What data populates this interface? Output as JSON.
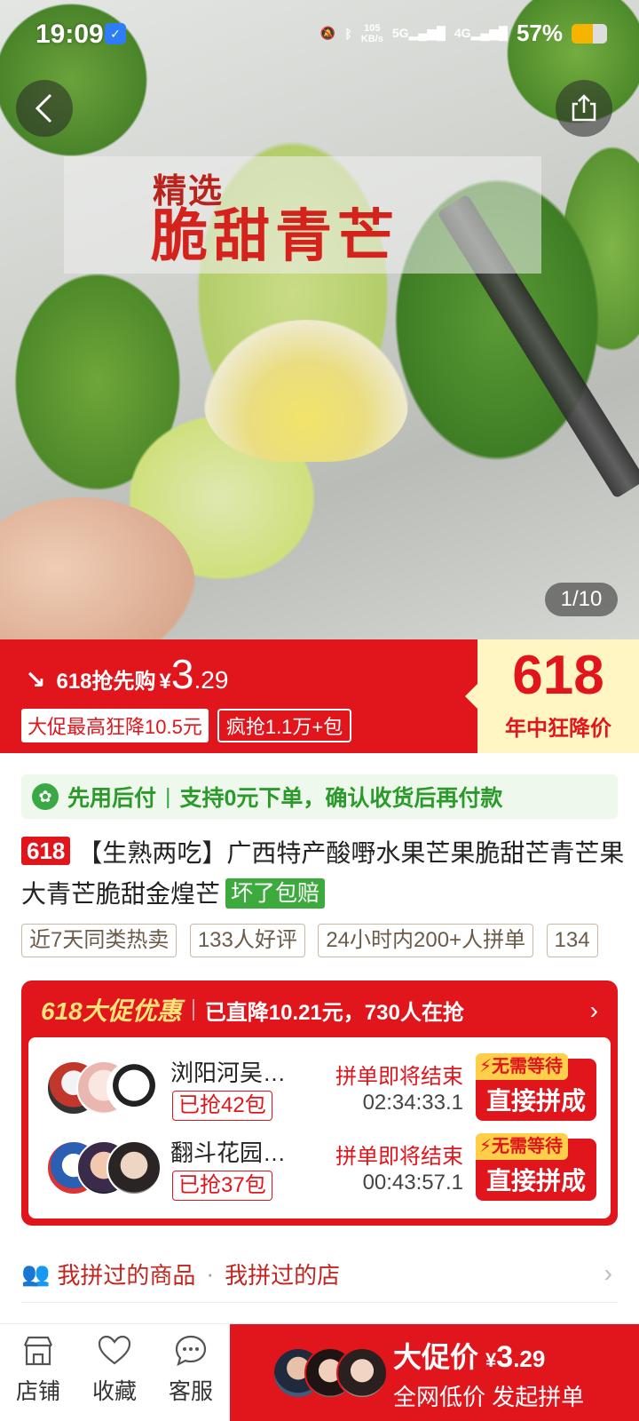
{
  "status_bar": {
    "time": "19:09",
    "net_speed": "105",
    "net_unit": "KB/s",
    "network": "5G",
    "network2": "4G",
    "battery": "57%"
  },
  "hero": {
    "banner_line1": "精选",
    "banner_line2": "脆甜青芒",
    "counter": "1/10"
  },
  "price_bar": {
    "label": "618抢先购",
    "currency": "¥",
    "price_int": "3",
    "price_dec": ".29",
    "tag1": "大促最高狂降10.5元",
    "tag2": "疯抢1.1万+包",
    "promo_num": "618",
    "promo_text": "年中狂降价"
  },
  "pay_later": {
    "title": "先用后付",
    "desc": "支持0元下单，确认收货后再付款"
  },
  "product": {
    "badge": "618",
    "title": "【生熟两吃】广西特产酸嘢水果芒果脆甜芒青芒果大青芒脆甜金煌芒",
    "guarantee": "坏了包赔"
  },
  "chips": [
    "近7天同类热卖",
    "133人好评",
    "24小时内200+人拼单",
    "134"
  ],
  "group_buy": {
    "title": "618大促优惠",
    "subtitle": "已直降10.21元，730人在抢",
    "groups": [
      {
        "name": "浏阳河吴…",
        "count": "已抢42包",
        "status": "拼单即将结束",
        "timer": "02:34:33.1",
        "tag": "无需等待",
        "button": "直接拼成"
      },
      {
        "name": "翻斗花园…",
        "count": "已抢37包",
        "status": "拼单即将结束",
        "timer": "00:43:57.1",
        "tag": "无需等待",
        "button": "直接拼成"
      }
    ]
  },
  "history": {
    "link1": "我拼过的商品",
    "link2": "我拼过的店"
  },
  "bottom_bar": {
    "shop": "店铺",
    "favorite": "收藏",
    "service": "客服",
    "buy_title": "大促价",
    "buy_currency": "¥",
    "buy_int": "3",
    "buy_dec": ".29",
    "buy_sub": "全网低价 发起拼单"
  },
  "colors": {
    "accent": "#e0161c",
    "green": "#3caa3c",
    "promo_bg": "#fff6c4"
  }
}
